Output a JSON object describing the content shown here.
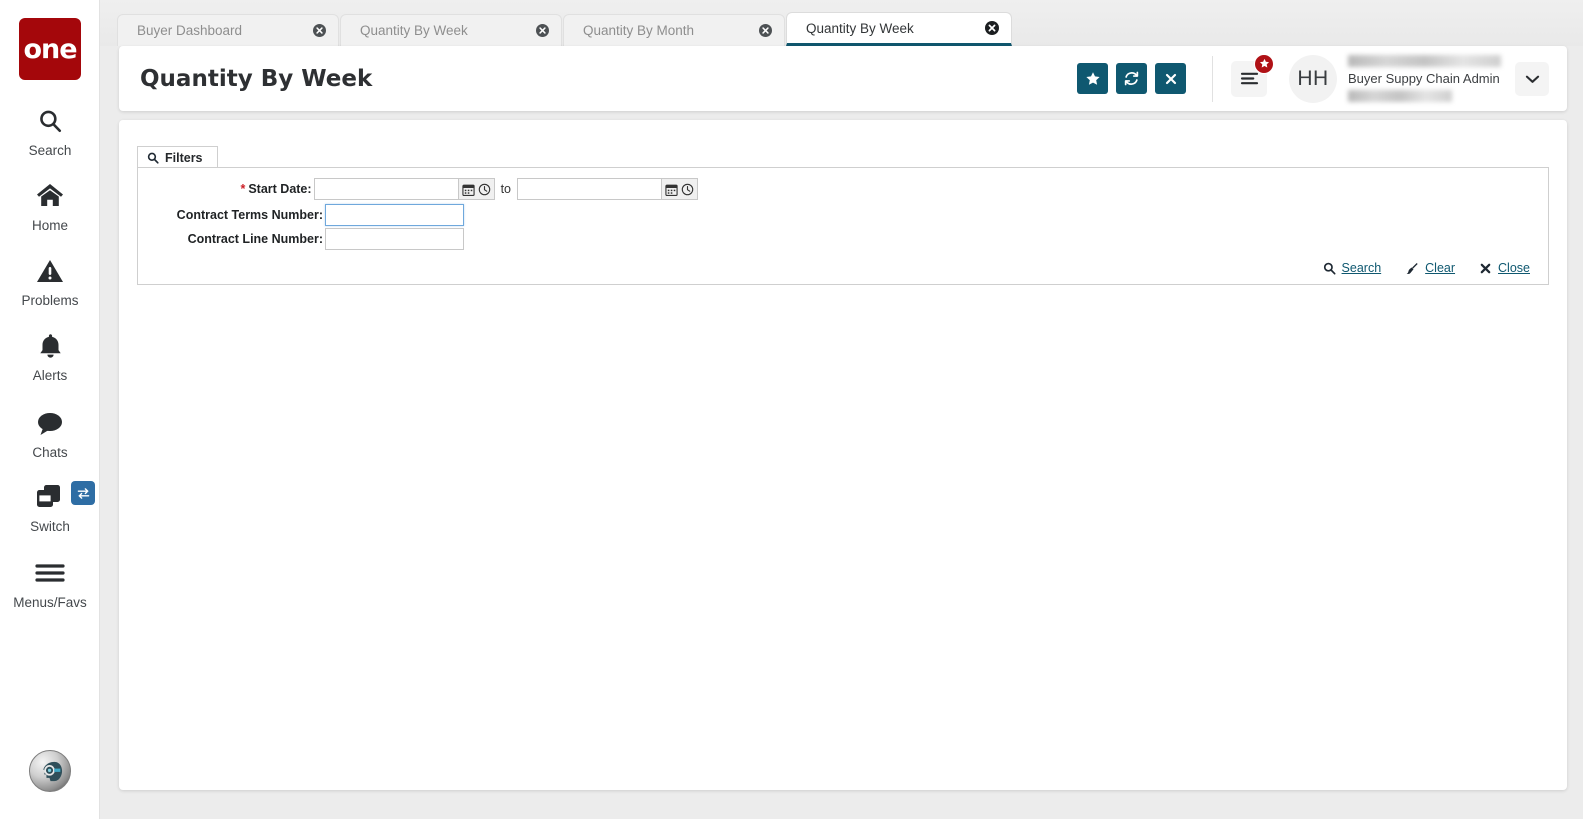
{
  "brand": {
    "logo_text": "one"
  },
  "sidebar": {
    "items": [
      {
        "label": "Search",
        "icon": "search-icon"
      },
      {
        "label": "Home",
        "icon": "home-icon"
      },
      {
        "label": "Problems",
        "icon": "warning-triangle-icon"
      },
      {
        "label": "Alerts",
        "icon": "bell-icon"
      },
      {
        "label": "Chats",
        "icon": "chat-bubble-icon"
      },
      {
        "label": "Switch",
        "icon": "switch-windows-icon"
      },
      {
        "label": "Menus/Favs",
        "icon": "hamburger-icon"
      }
    ],
    "switch_badge_icon": "exchange-arrows-icon",
    "assistant_icon": "ai-assistant-head-icon"
  },
  "tabs": [
    {
      "label": "Buyer Dashboard",
      "active": false
    },
    {
      "label": "Quantity By Week",
      "active": false
    },
    {
      "label": "Quantity By Month",
      "active": false
    },
    {
      "label": "Quantity By Week",
      "active": true
    }
  ],
  "header": {
    "title": "Quantity By Week",
    "buttons": [
      {
        "name": "favorite-button",
        "icon": "star-icon"
      },
      {
        "name": "refresh-button",
        "icon": "refresh-icon"
      },
      {
        "name": "close-page-button",
        "icon": "close-x-icon"
      }
    ],
    "menu_icon": "hamburger-menu-icon",
    "menu_badge_icon": "star-badge-icon",
    "avatar_initials": "HH",
    "user_role": "Buyer Suppy Chain Admin",
    "caret_icon": "chevron-down-icon"
  },
  "filters": {
    "tab_label": "Filters",
    "tab_icon": "search-icon",
    "fields": {
      "start_date": {
        "label": "Start Date:",
        "required": true,
        "from_value": "",
        "to_value": "",
        "separator": "to",
        "calendar_icon": "calendar-icon",
        "clock_icon": "clock-icon"
      },
      "contract_terms_number": {
        "label": "Contract Terms Number:",
        "value": "",
        "focused": true
      },
      "contract_line_number": {
        "label": "Contract Line Number:",
        "value": "",
        "focused": false
      }
    },
    "actions": [
      {
        "label": "Search",
        "icon": "search-icon"
      },
      {
        "label": "Clear",
        "icon": "broom-icon"
      },
      {
        "label": "Close",
        "icon": "close-x-icon"
      }
    ]
  },
  "colors": {
    "brand_red": "#a4070b",
    "teal": "#0f5870",
    "badge_red": "#b01116",
    "switch_blue": "#2e6da4",
    "focus_blue": "#6fa8dc",
    "page_bg": "#ececec"
  }
}
